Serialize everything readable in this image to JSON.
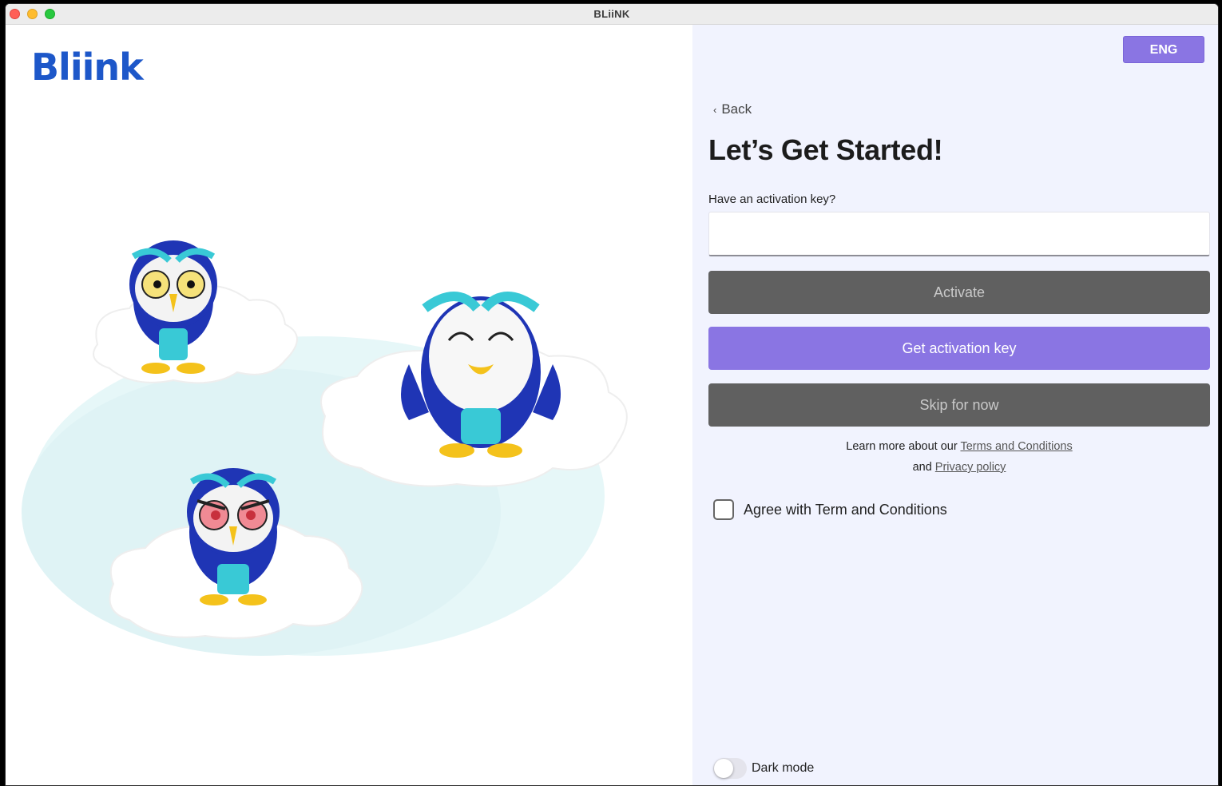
{
  "window": {
    "title": "BLiiNK"
  },
  "brand": {
    "logo_text": "Bliink",
    "color": "#1d57c9"
  },
  "header": {
    "language": "ENG"
  },
  "form": {
    "back_label": "Back",
    "title": "Let’s Get Started!",
    "key_label": "Have an activation key?",
    "key_value": "",
    "activate_label": "Activate",
    "get_key_label": "Get activation key",
    "skip_label": "Skip for now",
    "legal_prefix": "Learn more about our",
    "terms_link": "Terms and Conditions",
    "legal_and": "and",
    "privacy_link": "Privacy policy",
    "agree_label": "Agree with Term and Conditions",
    "agree_checked": false
  },
  "footer": {
    "dark_mode_label": "Dark mode",
    "dark_mode_on": false
  },
  "colors": {
    "accent": "#8a75e3",
    "disabled_button": "#606060",
    "right_panel_bg": "#f1f3fe",
    "owl_blue": "#1f35b5",
    "owl_teal": "#39c9d6",
    "owl_beak": "#f4c21b"
  },
  "illustration": {
    "icons": [
      "owl-surprised-icon",
      "owl-happy-icon",
      "owl-angry-icon",
      "cloud-icon"
    ]
  }
}
